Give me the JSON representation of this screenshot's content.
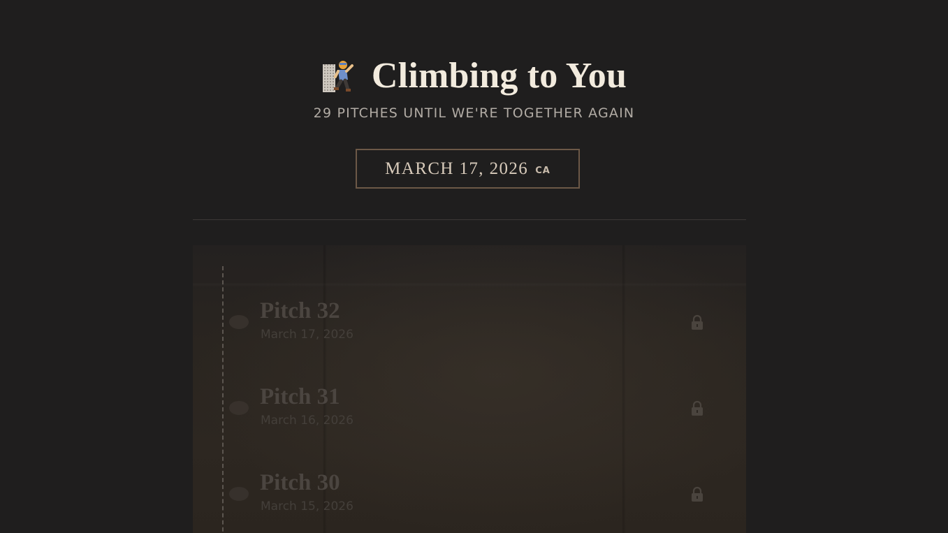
{
  "header": {
    "title": "Climbing to You",
    "icon": "climber-icon",
    "subtitle": "29 PITCHES UNTIL WE'RE TOGETHER AGAIN"
  },
  "date_selector": {
    "date": "MARCH 17, 2026",
    "zone": "CA"
  },
  "pitches": [
    {
      "title": "Pitch 32",
      "date": "March 17, 2026",
      "status_icon": "lock-icon"
    },
    {
      "title": "Pitch 31",
      "date": "March 16, 2026",
      "status_icon": "lock-icon"
    },
    {
      "title": "Pitch 30",
      "date": "March 15, 2026",
      "status_icon": "lock-icon"
    }
  ],
  "colors": {
    "background": "#1f1e1e",
    "title": "#f2ebde",
    "accent_border": "#6c5847",
    "locked_text": "#4b4540"
  }
}
